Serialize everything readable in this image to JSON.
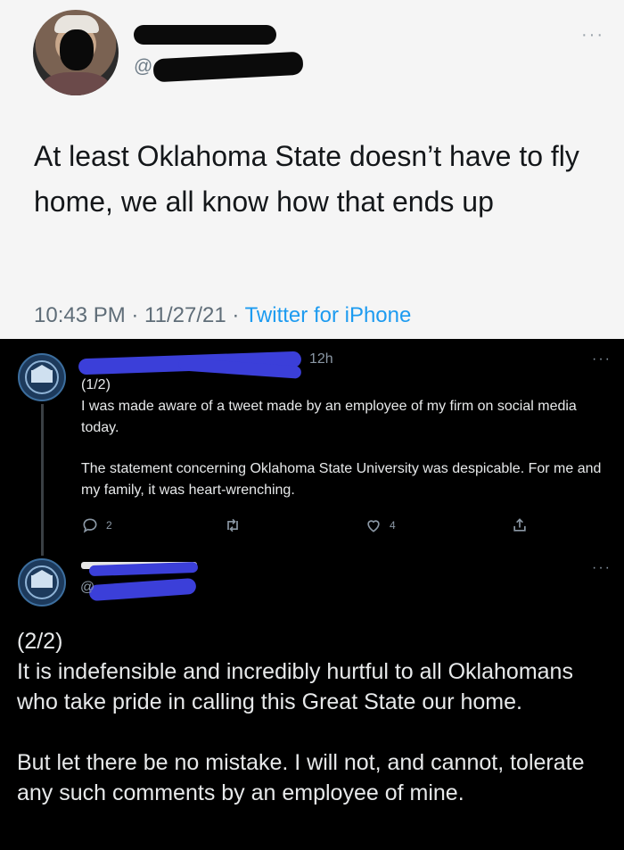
{
  "tweet1": {
    "handle_prefix": "@",
    "more": "···",
    "text": "At least Oklahoma State doesn’t have to fly home, we all know how that ends up",
    "time": "10:43 PM · 11/27/21 · ",
    "source": "Twitter for iPhone"
  },
  "tweet2": {
    "time": "12h",
    "more": "···",
    "paragraphs": [
      "(1/2)\nI was made aware of a tweet made by an employee of my firm on social media today.",
      "The statement concerning Oklahoma State University was despicable. For me and my family, it was heart-wrenching."
    ],
    "reply_count": "2",
    "like_count": "4"
  },
  "tweet3": {
    "handle_prefix": "@",
    "more": "···",
    "paragraphs": [
      "(2/2)\nIt is indefensible and incredibly hurtful to all Oklahomans who take pride in calling this Great State our home.",
      "But let there be no mistake. I will not, and cannot, tolerate any such comments by an employee of mine."
    ]
  }
}
